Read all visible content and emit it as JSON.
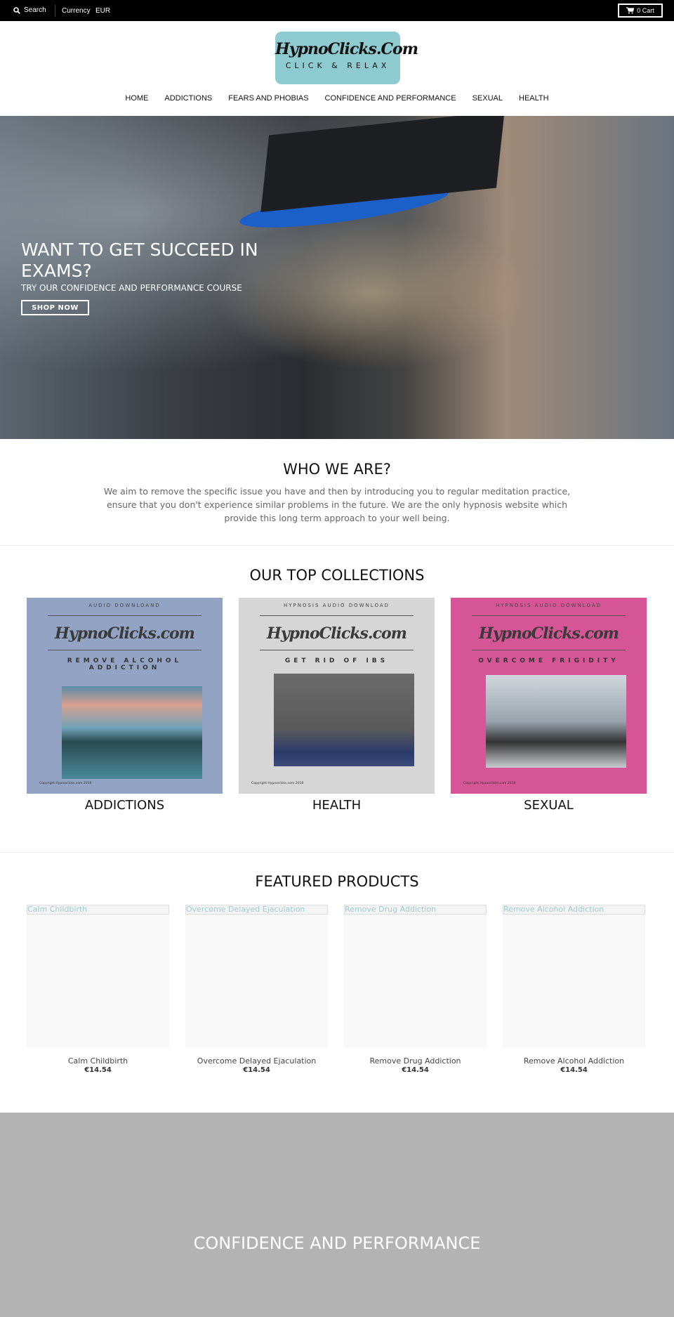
{
  "topbar": {
    "search_label": "Search",
    "currency_label": "Currency",
    "currency_value": "EUR",
    "cart_label": "0 Cart"
  },
  "logo": {
    "line1": "HypnoClicks.Com",
    "line2": "CLICK & RELAX",
    "color": "#8ecbd1"
  },
  "nav": [
    {
      "label": "HOME"
    },
    {
      "label": "ADDICTIONS"
    },
    {
      "label": "FEARS AND PHOBIAS"
    },
    {
      "label": "CONFIDENCE AND PERFORMANCE"
    },
    {
      "label": "SEXUAL"
    },
    {
      "label": "HEALTH"
    }
  ],
  "hero": {
    "headline": "WANT TO GET SUCCEED IN EXAMS?",
    "subtitle": "TRY OUR CONFIDENCE AND PERFORMANCE COURSE",
    "button": "SHOP NOW"
  },
  "about": {
    "title": "WHO WE ARE?",
    "text": "We aim to remove the specific issue you have and then by introducing you to regular meditation practice, ensure that you don't experience similar problems in the future. We are the only hypnosis website which provide this long term approach to your well being."
  },
  "collections": {
    "title": "OUR TOP COLLECTIONS",
    "items": [
      {
        "label": "ADDICTIONS",
        "cover_top": "AUDIO DOWNLOAND",
        "cover_brand": "HypnoClicks.com",
        "cover_sub": "REMOVE ALCOHOL ADDICTION",
        "copyright": "Copyright Hypnoclicks.com 2018",
        "bg": "#93a3c4"
      },
      {
        "label": "HEALTH",
        "cover_top": "HYPNOSIS AUDIO DOWNLOAD",
        "cover_brand": "HypnoClicks.com",
        "cover_sub": "GET RID OF IBS",
        "copyright": "Copyright Hypnoclicks.com 2018",
        "bg": "#d6d6d6"
      },
      {
        "label": "SEXUAL",
        "cover_top": "HYPNOSIS AUDIO DOWNLOAD",
        "cover_brand": "HypnoClicks.com",
        "cover_sub": "OVERCOME FRIGIDITY",
        "copyright": "Copyright Hypnoclicks.com 2018",
        "bg": "#d65597"
      }
    ]
  },
  "featured": {
    "title": "FEATURED PRODUCTS",
    "items": [
      {
        "name": "Calm Childbirth",
        "price": "€14.54"
      },
      {
        "name": "Overcome Delayed Ejaculation",
        "price": "€14.54"
      },
      {
        "name": "Remove Drug Addiction",
        "price": "€14.54"
      },
      {
        "name": "Remove Alcohol Addiction",
        "price": "€14.54"
      }
    ]
  },
  "banner": {
    "title": "CONFIDENCE AND PERFORMANCE"
  }
}
